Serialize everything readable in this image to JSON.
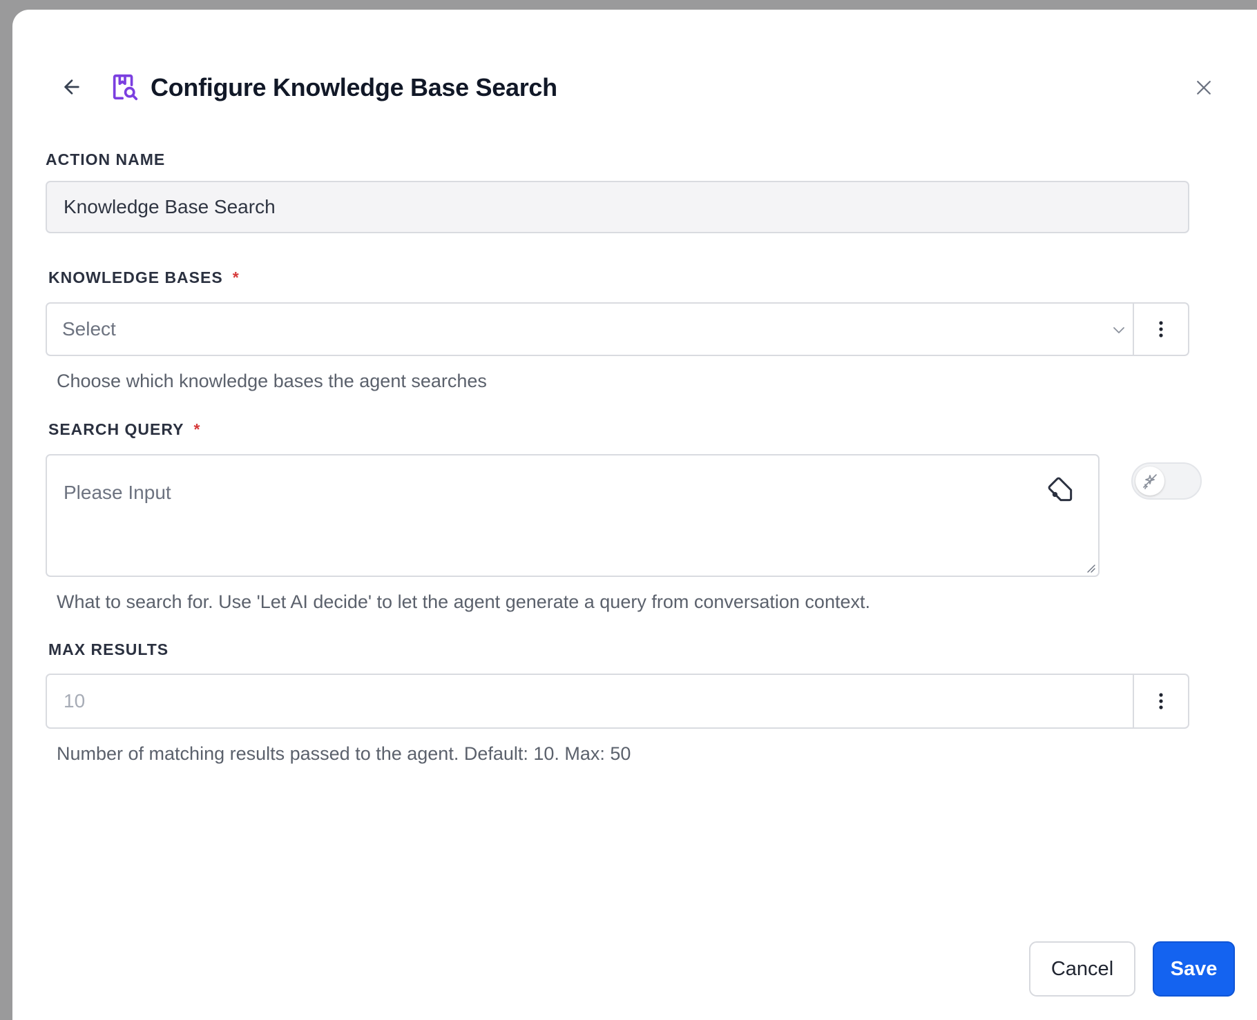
{
  "header": {
    "title": "Configure Knowledge Base Search",
    "back_icon": "arrow-left-icon",
    "title_icon": "knowledge-search-icon",
    "close_icon": "close-icon"
  },
  "action_name": {
    "label": "ACTION NAME",
    "value": "Knowledge Base Search"
  },
  "knowledge_bases": {
    "label": "KNOWLEDGE BASES",
    "required_mark": "*",
    "placeholder": "Select",
    "help": "Choose which knowledge bases the agent searches"
  },
  "search_query": {
    "label": "SEARCH QUERY",
    "required_mark": "*",
    "placeholder": "Please Input",
    "help": "What to search for. Use 'Let AI decide' to let the agent generate a query from conversation context."
  },
  "max_results": {
    "label": "MAX RESULTS",
    "placeholder": "10",
    "help": "Number of matching results passed to the agent. Default: 10. Max: 50"
  },
  "footer": {
    "cancel_label": "Cancel",
    "save_label": "Save"
  },
  "colors": {
    "accent": "#1463f0",
    "icon_purple": "#7b3fe0",
    "required": "#d63a3a"
  }
}
